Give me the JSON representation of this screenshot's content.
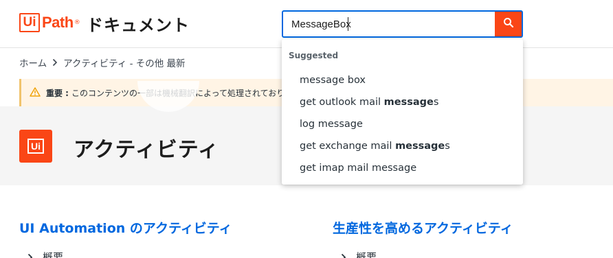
{
  "header": {
    "logo_ui": "Ui",
    "logo_path": "Path",
    "logo_reg": "®",
    "site_title": "ドキュメント",
    "search": {
      "value": "MessageBox",
      "button_icon": "search-icon"
    }
  },
  "breadcrumb": {
    "items": [
      "ホーム",
      "アクティビティ - その他 最新"
    ],
    "separator_icon": "chevron-right-icon"
  },
  "notice": {
    "icon": "warning-icon",
    "label": "重要 :",
    "text": "このコンテンツの一部は機械翻訳によって処理されており、"
  },
  "hero": {
    "icon_label": "Ui",
    "title": "アクティビティ"
  },
  "sections": [
    {
      "title": "UI Automation のアクティビティ",
      "first_item": "概要"
    },
    {
      "title": "生産性を高めるアクティビティ",
      "first_item": "概要"
    }
  ],
  "suggestions": {
    "heading": "Suggested",
    "items": [
      {
        "pre": "message box",
        "bold": "",
        "post": ""
      },
      {
        "pre": "get outlook mail ",
        "bold": "message",
        "post": "s"
      },
      {
        "pre": "log message",
        "bold": "",
        "post": ""
      },
      {
        "pre": "get exchange mail ",
        "bold": "message",
        "post": "s"
      },
      {
        "pre": "get imap mail message",
        "bold": "",
        "post": ""
      }
    ]
  },
  "colors": {
    "brand": "#fa4616",
    "link": "#0067df",
    "notice_bg": "#fff4e5",
    "warning": "#f0a30a"
  }
}
